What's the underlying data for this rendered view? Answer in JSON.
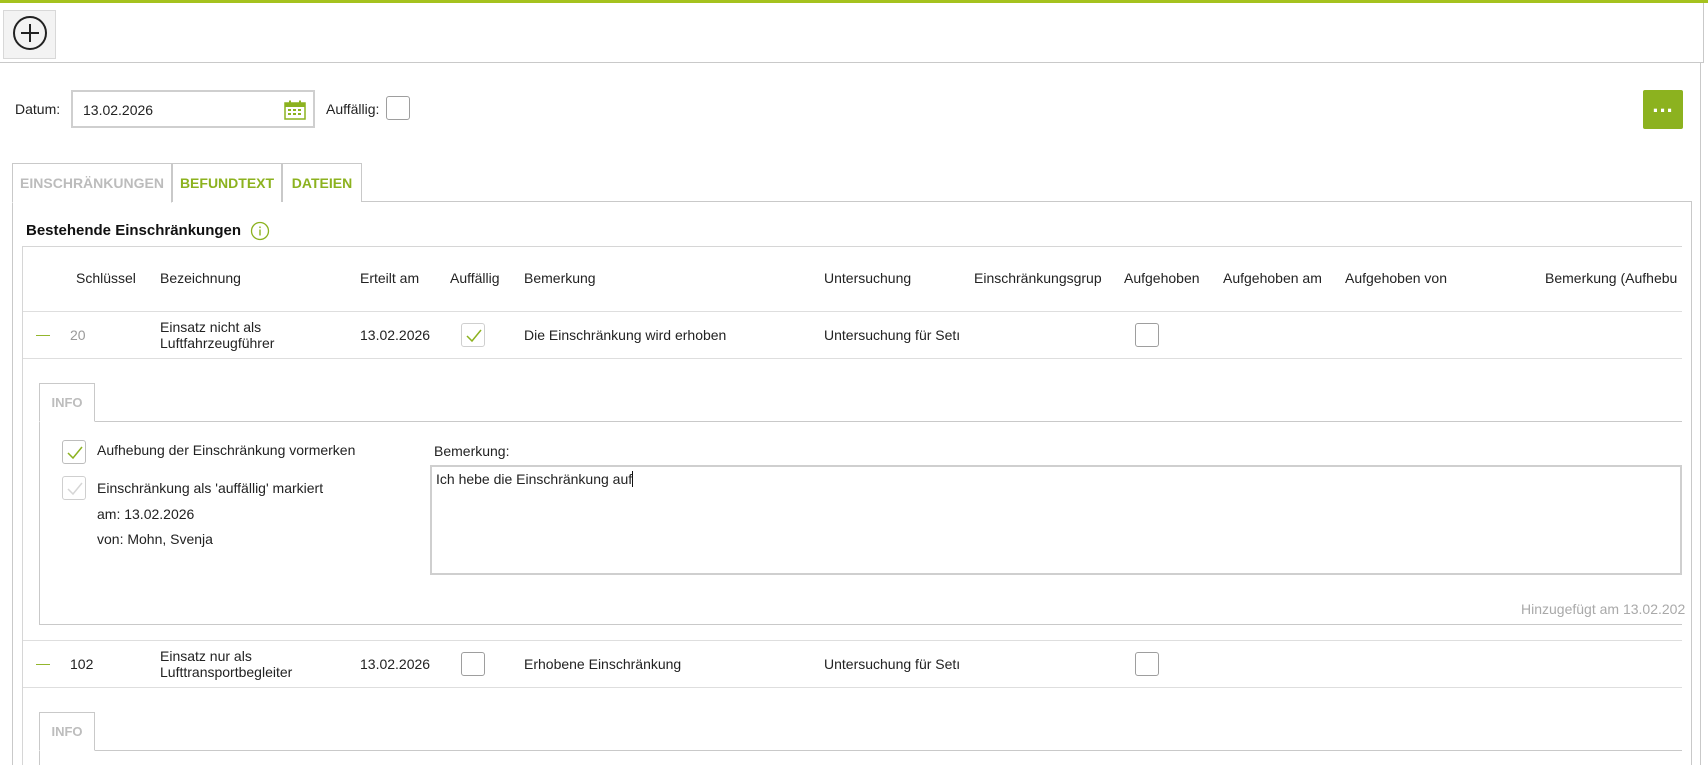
{
  "colors": {
    "accent": "#8cb21f",
    "accent_top_line": "#a5c21e",
    "disabled_text": "#bcbcbc"
  },
  "toolbar": {
    "add_icon": "plus-circle-icon"
  },
  "filter": {
    "date_label": "Datum:",
    "date_value": "13.02.2026",
    "calendar_icon": "calendar-icon",
    "conspicuous_label": "Auffällig:",
    "conspicuous_checked": false,
    "more_label": "..."
  },
  "tabs": [
    {
      "label": "EINSCHRÄNKUNGEN",
      "active": true
    },
    {
      "label": "BEFUNDTEXT",
      "active": false
    },
    {
      "label": "DATEIEN",
      "active": false
    }
  ],
  "section": {
    "title": "Bestehende Einschränkungen",
    "info_icon": "info-icon"
  },
  "columns": [
    "Schlüssel",
    "Bezeichnung",
    "Erteilt am",
    "Auffällig",
    "Bemerkung",
    "Untersuchung",
    "Einschränkungsgrup",
    "Aufgehoben",
    "Aufgehoben am",
    "Aufgehoben von",
    "Bemerkung (Aufhebu"
  ],
  "rows": [
    {
      "expander": "—",
      "key": "20",
      "name_line1": "Einsatz nicht als",
      "name_line2": "Luftfahrzeugführer",
      "granted": "13.02.2026",
      "conspicuous": true,
      "remark": "Die Einschränkung wird erhoben",
      "exam": "Untersuchung für Setı",
      "revoked": false,
      "detail": {
        "tab": "INFO",
        "mark_revoke_label": "Aufhebung der Einschränkung vormerken",
        "mark_revoke_checked": true,
        "marked_conspicuous_label": "Einschränkung als 'auffällig' markiert",
        "marked_on": "am: 13.02.2026",
        "marked_by": "von: Mohn, Svenja",
        "remark_label": "Bemerkung:",
        "remark_value": "Ich hebe die Einschränkung auf",
        "added_note": "Hinzugefügt am 13.02.202"
      }
    },
    {
      "expander": "—",
      "key": "102",
      "name_line1": "Einsatz nur als",
      "name_line2": "Lufttransportbegleiter",
      "granted": "13.02.2026",
      "conspicuous": false,
      "remark": "Erhobene Einschränkung",
      "exam": "Untersuchung für Setı",
      "revoked": false,
      "detail": {
        "tab": "INFO"
      }
    }
  ]
}
